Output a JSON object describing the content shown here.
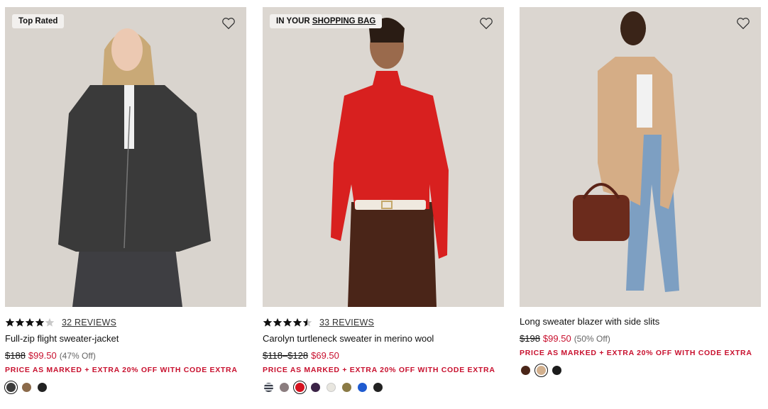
{
  "products": [
    {
      "badge": "Top Rated",
      "rating": 4,
      "reviews": "32 REVIEWS",
      "name": "Full-zip flight sweater-jacket",
      "orig_price": "$188",
      "sale_price": "$99.50",
      "discount": "(47% Off)",
      "promo": "PRICE AS MARKED + EXTRA 20% OFF WITH CODE EXTRA",
      "swatches": [
        {
          "color": "#3c3c3c",
          "selected": true
        },
        {
          "color": "#8b6a4a",
          "selected": false
        },
        {
          "color": "#222222",
          "selected": false
        }
      ]
    },
    {
      "badge_prefix": "IN YOUR ",
      "badge_link": "SHOPPING BAG",
      "rating": 4.5,
      "reviews": "33 REVIEWS",
      "name": "Carolyn turtleneck sweater in merino wool",
      "orig_price": "$118–$128",
      "sale_price": "$69.50",
      "promo": "PRICE AS MARKED + EXTRA 20% OFF WITH CODE EXTRA",
      "swatches": [
        {
          "color": "#8a8d94",
          "selected": false,
          "striped": true
        },
        {
          "color": "#8b7d7f",
          "selected": false
        },
        {
          "color": "#d6121f",
          "selected": true
        },
        {
          "color": "#3b2346",
          "selected": false
        },
        {
          "color": "#e8e6df",
          "selected": false
        },
        {
          "color": "#8a7a45",
          "selected": false
        },
        {
          "color": "#1f5bd0",
          "selected": false
        },
        {
          "color": "#222222",
          "selected": false
        }
      ]
    },
    {
      "name": "Long sweater blazer with side slits",
      "orig_price": "$198",
      "sale_price": "$99.50",
      "discount": "(50% Off)",
      "promo": "PRICE AS MARKED + EXTRA 20% OFF WITH CODE EXTRA",
      "swatches": [
        {
          "color": "#4a2618",
          "selected": false
        },
        {
          "color": "#d2b08e",
          "selected": true
        },
        {
          "color": "#1c1c1c",
          "selected": false
        }
      ]
    }
  ],
  "colors": {
    "sale": "#c8102e",
    "bg_photo": "#ddd7d1"
  },
  "icons": {
    "wishlist": "heart-outline-icon",
    "rating": "star-icon"
  }
}
